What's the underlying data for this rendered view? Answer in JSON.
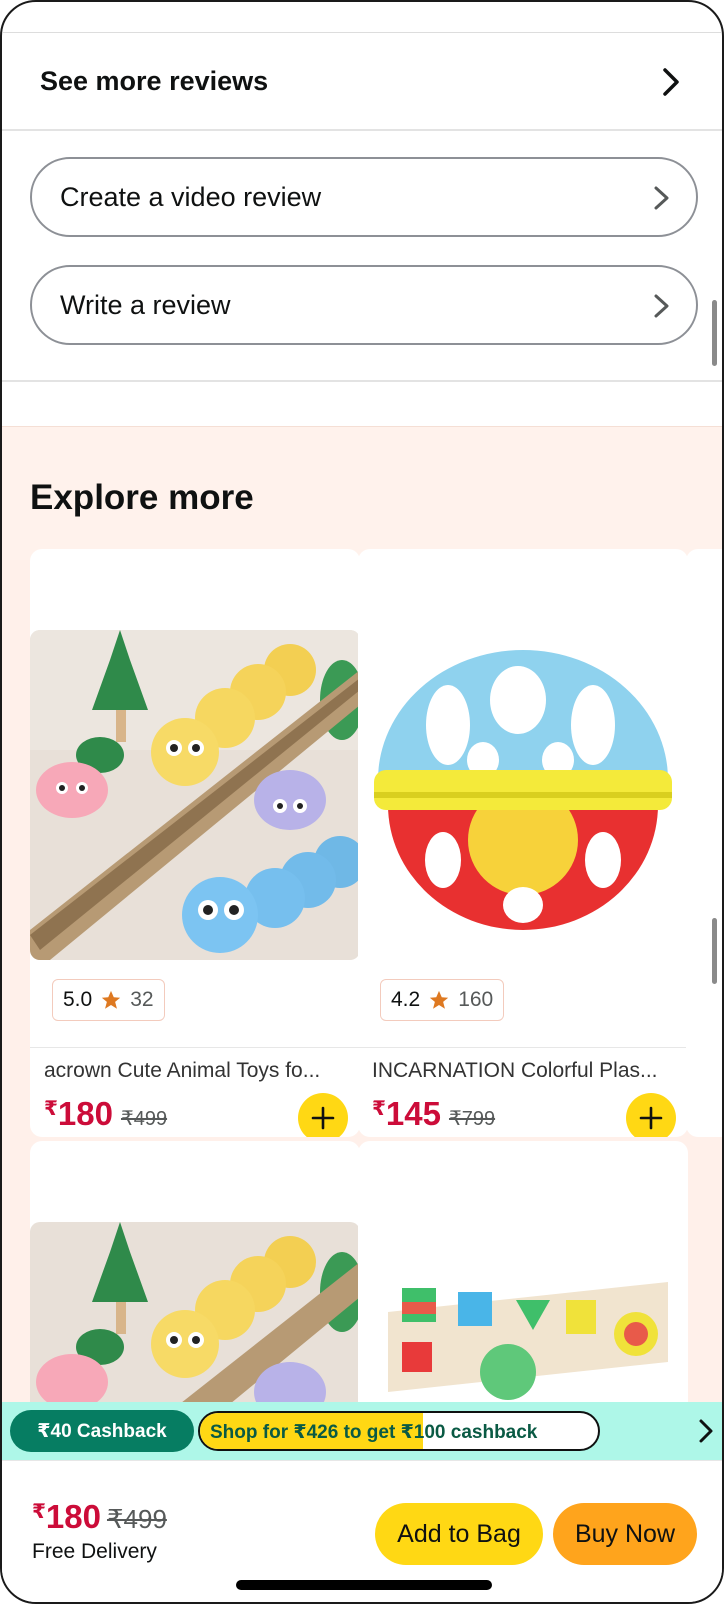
{
  "reviews": {
    "see_more_label": "See more reviews",
    "create_video_label": "Create a video review",
    "write_label": "Write a review"
  },
  "explore": {
    "title": "Explore more",
    "products": [
      {
        "rating": "5.0",
        "rating_count": "32",
        "title": "acrown Cute Animal Toys fo...",
        "currency": "₹",
        "price": "180",
        "mrp": "₹499",
        "image_icon": "caterpillar-toys-image"
      },
      {
        "rating": "4.2",
        "rating_count": "160",
        "title": "INCARNATION Colorful Plas...",
        "currency": "₹",
        "price": "145",
        "mrp": "₹799",
        "image_icon": "rattle-ball-image"
      }
    ]
  },
  "cashback": {
    "badge": "₹40 Cashback",
    "message": "Shop for ₹426 to get ₹100 cashback",
    "progress": 0.56
  },
  "bottom": {
    "currency": "₹",
    "price": "180",
    "mrp": "₹499",
    "delivery": "Free Delivery",
    "add_to_bag": "Add to Bag",
    "buy_now": "Buy Now"
  },
  "colors": {
    "price_red": "#cc0c39",
    "yellow_button": "#ffd814",
    "orange_button": "#ffa41c",
    "cashback_green": "#067d62",
    "star": "#de7921"
  }
}
